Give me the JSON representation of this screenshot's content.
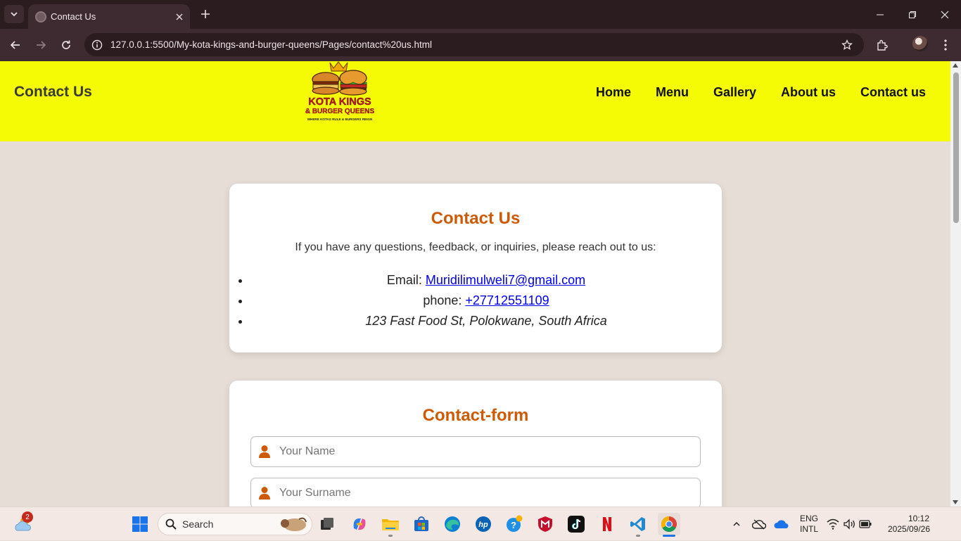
{
  "browser": {
    "tab_title": "Contact Us",
    "url": "127.0.0.1:5500/My-kota-kings-and-burger-queens/Pages/contact%20us.html"
  },
  "site": {
    "header_title": "Contact Us",
    "logo": {
      "line1": "KOTA KINGS",
      "line2": "& BURGER QUEENS",
      "tagline": "WHERE KOTAS RULE & BURGERS REIGN"
    },
    "nav": [
      "Home",
      "Menu",
      "Gallery",
      "About us",
      "Contact us"
    ]
  },
  "contact_card": {
    "heading": "Contact Us",
    "intro": "If you have any questions, feedback, or inquiries, please reach out to us:",
    "email_label": "Email:",
    "email": "Muridilimulweli7@gmail.com",
    "phone_label": "phone:",
    "phone": "+27712551109",
    "address": "123 Fast Food St, Polokwane, South Africa"
  },
  "form": {
    "heading": "Contact-form",
    "name_placeholder": "Your Name",
    "surname_placeholder": "Your Surname"
  },
  "taskbar": {
    "search_label": "Search",
    "weather_badge": "2",
    "lang_line1": "ENG",
    "lang_line2": "INTL",
    "time": "10:12",
    "date": "2025/09/26"
  },
  "colors": {
    "header_yellow": "#f5fb05",
    "heading_orange": "#cc5a06",
    "page_bg": "#e6ded6",
    "link_blue": "#0000ee"
  }
}
